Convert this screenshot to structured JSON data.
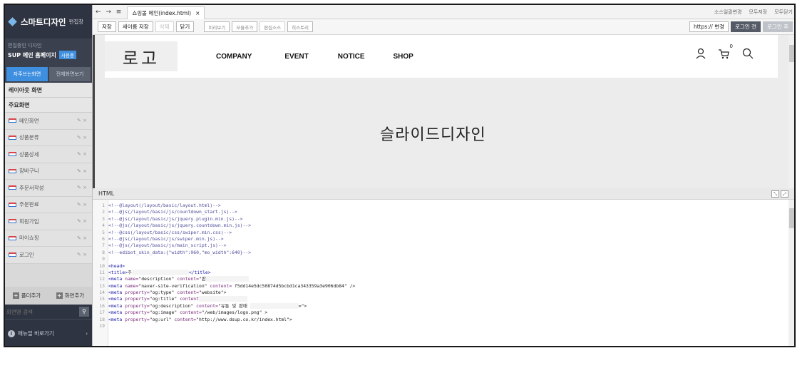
{
  "sidebar": {
    "app_title": "스마트디자인",
    "app_subtitle": "편집창",
    "editing_label": "편집중인 디자인",
    "editing_site": "SUP 메인 홈페이지",
    "editing_badge": "사용중",
    "tabs": [
      {
        "label": "자주쓰는화면",
        "active": true
      },
      {
        "label": "전체화면보기",
        "active": false
      }
    ],
    "section_layout": "레이아웃 화면",
    "section_main": "주요화면",
    "pages": [
      {
        "label": "메인화면"
      },
      {
        "label": "상품분류"
      },
      {
        "label": "상품상세"
      },
      {
        "label": "장바구니"
      },
      {
        "label": "주문서작성"
      },
      {
        "label": "주문완료"
      },
      {
        "label": "회원가입"
      },
      {
        "label": "마이쇼핑"
      },
      {
        "label": "로그인"
      }
    ],
    "page_actions": "✎ ×",
    "add_folder": "폴더추가",
    "add_page": "화면추가",
    "search_placeholder": "화면명 검색",
    "manual_link": "매뉴얼 바로가기"
  },
  "tabbar": {
    "nav": "← → ≡",
    "doc_tab": "쇼핑몰 메인(index.html)",
    "doc_close": "×",
    "links": [
      "소스일괄변경",
      "모두저장",
      "모두닫기"
    ]
  },
  "toolbar": {
    "save": "저장",
    "save_as": "새이름 저장",
    "delete": "삭제",
    "close": "닫기",
    "preview": "미리보기",
    "add_module": "모듈추가",
    "source": "편집소스",
    "history": "히스토리",
    "https_change": "https:// 변경",
    "before_login": "로그인 전",
    "after_login": "로그인 후"
  },
  "preview": {
    "logo": "로고",
    "nav": [
      "COMPANY",
      "EVENT",
      "NOTICE",
      "SHOP"
    ],
    "cart_count": "0",
    "slide_text": "슬라이드디자인"
  },
  "code_panel": {
    "title": "HTML",
    "lines": [
      {
        "n": "1",
        "parts": [
          [
            "c-comment",
            "<!--@layout(/layout/basic/layout.html)-->"
          ]
        ]
      },
      {
        "n": "2",
        "parts": [
          [
            "c-comment",
            "<!--@js(/layout/basic/js/countdown_start.js)-->"
          ]
        ]
      },
      {
        "n": "3",
        "parts": [
          [
            "c-comment",
            "<!--@js(/layout/basic/js/jquery.plugin.min.js)-->"
          ]
        ]
      },
      {
        "n": "4",
        "parts": [
          [
            "c-comment",
            "<!--@js(/layout/basic/js/jquery.countdown.min.js)-->"
          ]
        ]
      },
      {
        "n": "5",
        "parts": [
          [
            "c-comment",
            "<!--@css(/layout/basic/css/swiper.min.css)-->"
          ]
        ]
      },
      {
        "n": "6",
        "parts": [
          [
            "c-comment",
            "<!--@js(/layout/basic/js/swiper.min.js)-->"
          ]
        ]
      },
      {
        "n": "7",
        "parts": [
          [
            "c-comment",
            "<!--@js(/layout/basic/js/main_script.js)-->"
          ]
        ]
      },
      {
        "n": "8",
        "parts": [
          [
            "c-comment",
            "<!--edibot_skin_data:{\"width\":960,\"mo_width\":640}-->"
          ]
        ]
      },
      {
        "n": "9",
        "parts": []
      },
      {
        "n": "10",
        "parts": [
          [
            "c-tag",
            "<head>"
          ]
        ]
      },
      {
        "n": "11",
        "parts": [
          [
            "c-tag",
            "<title>"
          ],
          [
            "c-text",
            "주"
          ],
          [
            "blank",
            "                    "
          ],
          [
            "c-tag",
            "</title>"
          ]
        ]
      },
      {
        "n": "12",
        "parts": [
          [
            "c-tag",
            "<meta "
          ],
          [
            "c-attr",
            "name="
          ],
          [
            "c-val",
            "\"description\" "
          ],
          [
            "c-attr",
            "content="
          ],
          [
            "c-val",
            "\"판"
          ],
          [
            "blank",
            "               "
          ]
        ]
      },
      {
        "n": "13",
        "parts": [
          [
            "c-tag",
            "<meta "
          ],
          [
            "c-attr",
            "name="
          ],
          [
            "c-val",
            "\"naver-site-verification\" "
          ],
          [
            "c-attr",
            "content="
          ],
          [
            "c-val",
            " f5dd14e5dc50874d5bcbd1ca343359a3e906db84\" />"
          ]
        ]
      },
      {
        "n": "14",
        "parts": [
          [
            "c-tag",
            "<meta "
          ],
          [
            "c-attr",
            "property="
          ],
          [
            "c-val",
            "\"og:type\" "
          ],
          [
            "c-attr",
            "content="
          ],
          [
            "c-val",
            "\"website\">"
          ]
        ]
      },
      {
        "n": "15",
        "parts": [
          [
            "c-tag",
            "<meta "
          ],
          [
            "c-attr",
            "property="
          ],
          [
            "c-val",
            "\"og:title\" "
          ],
          [
            "c-attr",
            "content"
          ],
          [
            "blank",
            "                 "
          ]
        ]
      },
      {
        "n": "16",
        "parts": [
          [
            "c-tag",
            "<meta "
          ],
          [
            "c-attr",
            "property="
          ],
          [
            "c-val",
            "\"og:description\" "
          ],
          [
            "c-attr",
            "content="
          ],
          [
            "c-val",
            "\"유통 및 판매 "
          ],
          [
            "blank",
            "                 "
          ],
          [
            "c-val",
            "=\">"
          ]
        ]
      },
      {
        "n": "17",
        "parts": [
          [
            "c-tag",
            "<meta "
          ],
          [
            "c-attr",
            "property="
          ],
          [
            "c-val",
            "\"og:image\" "
          ],
          [
            "c-attr",
            "content="
          ],
          [
            "c-val",
            "\"/web/images/logo.png\" >"
          ]
        ]
      },
      {
        "n": "18",
        "parts": [
          [
            "c-tag",
            "<meta "
          ],
          [
            "c-attr",
            "property="
          ],
          [
            "c-val",
            "\"og:url\" "
          ],
          [
            "c-attr",
            "content="
          ],
          [
            "c-val",
            "\"http://www.dsup.co.kr/index.html\">"
          ]
        ]
      },
      {
        "n": "19",
        "parts": []
      }
    ]
  },
  "colors": {
    "sidebar_dark": "#2e3441",
    "accent_blue": "#3f8fe0"
  }
}
